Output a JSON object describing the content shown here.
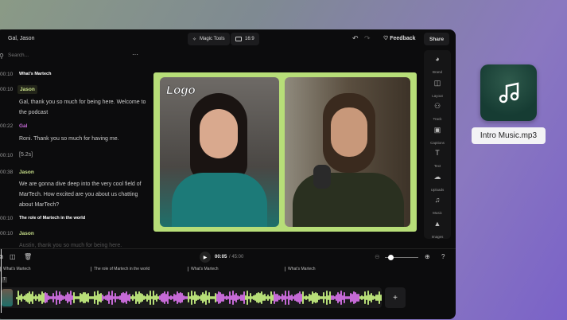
{
  "header": {
    "title": "Gal, Jason",
    "magic_tools": "Magic Tools",
    "ratio": "16:9",
    "feedback": "Feedback",
    "share": "Share"
  },
  "search": {
    "placeholder": "Search..."
  },
  "transcript": [
    {
      "time": "00:10",
      "kind": "chapter",
      "text": "What's Martech"
    },
    {
      "time": "00:10",
      "kind": "speaker",
      "speaker": "Jason",
      "text": "Gal, thank you so much for being here. Welcome to the podcast"
    },
    {
      "time": "00:22",
      "kind": "speaker",
      "speaker": "Gal",
      "text": "Roni. Thank you so much for having me."
    },
    {
      "time": "00:10",
      "kind": "pause",
      "text": "[5.2s]"
    },
    {
      "time": "00:38",
      "kind": "speaker",
      "speaker": "Jason",
      "text": "We are gonna dive deep into the very cool field of MarTech.  How excited are you about us chatting about MarTech?"
    },
    {
      "time": "00:10",
      "kind": "chapter",
      "text": "The role of Martech in the world"
    },
    {
      "time": "00:10",
      "kind": "speaker",
      "speaker": "Jason",
      "text": "Austin, thank you so much for being here."
    }
  ],
  "preview": {
    "logo": "Logo"
  },
  "tools": [
    {
      "label": "Brand",
      "icon": "palette"
    },
    {
      "label": "Layout",
      "icon": "layout"
    },
    {
      "label": "Track",
      "icon": "track"
    },
    {
      "label": "Captions",
      "icon": "captions"
    },
    {
      "label": "Text",
      "icon": "text"
    },
    {
      "label": "Uploads",
      "icon": "upload"
    },
    {
      "label": "Music",
      "icon": "music"
    },
    {
      "label": "Images",
      "icon": "image"
    }
  ],
  "player": {
    "current": "00:05",
    "total": "/ 45:00",
    "zoom": 0.1
  },
  "chapters": [
    "What's Martech",
    "The role of Martech in the world",
    "What's Martech",
    "What's Martech"
  ],
  "add_label": "+",
  "file": {
    "name": "Intro Music.mp3"
  },
  "colors": {
    "accent": "#b7de78",
    "speaker2": "#c56ad6"
  }
}
